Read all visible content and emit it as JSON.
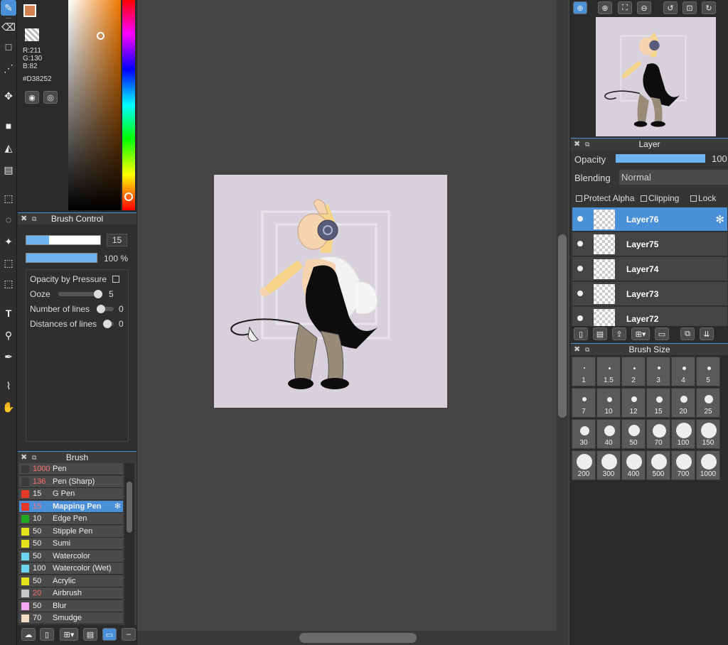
{
  "color": {
    "r_label": "R:211",
    "g_label": "G:130",
    "b_label": "B:82",
    "hex_label": "#D38252",
    "foreground": "#D38252",
    "accent": "#4A90D9"
  },
  "brush_control": {
    "title": "Brush Control",
    "size_value": "15",
    "opacity_value": "100 %",
    "opacity_by_pressure": "Opacity by Pressure",
    "ooze_label": "Ooze",
    "ooze_value": "5",
    "lines_label": "Number of lines",
    "lines_value": "0",
    "dist_label": "Distances of lines",
    "dist_value": "0"
  },
  "brush": {
    "title": "Brush",
    "items": [
      {
        "size": "1000",
        "name": "Pen",
        "color": "#3a3a3a",
        "red": true
      },
      {
        "size": "136",
        "name": "Pen (Sharp)",
        "color": "#3a3a3a",
        "red": true
      },
      {
        "size": "15",
        "name": "G Pen",
        "color": "#e53a2a",
        "red": false
      },
      {
        "size": "15",
        "name": "Mapping Pen",
        "color": "#e53a2a",
        "red": true
      },
      {
        "size": "10",
        "name": "Edge Pen",
        "color": "#21a821",
        "red": false
      },
      {
        "size": "50",
        "name": "Stipple Pen",
        "color": "#e8e21a",
        "red": false
      },
      {
        "size": "50",
        "name": "Sumi",
        "color": "#e8e21a",
        "red": false
      },
      {
        "size": "50",
        "name": "Watercolor",
        "color": "#6ed4f0",
        "red": false
      },
      {
        "size": "100",
        "name": "Watercolor (Wet)",
        "color": "#6ed4f0",
        "red": false
      },
      {
        "size": "50",
        "name": "Acrylic",
        "color": "#e8e21a",
        "red": false
      },
      {
        "size": "20",
        "name": "Airbrush",
        "color": "#c8c8c8",
        "red": true
      },
      {
        "size": "50",
        "name": "Blur",
        "color": "#f4a6f0",
        "red": false
      },
      {
        "size": "70",
        "name": "Smudge",
        "color": "#f6dcc4",
        "red": false
      }
    ]
  },
  "layer": {
    "title": "Layer",
    "opacity_label": "Opacity",
    "opacity_value": "100",
    "blending_label": "Blending",
    "blending_value": "Normal",
    "protect_alpha": "Protect Alpha",
    "clipping": "Clipping",
    "lock": "Lock",
    "layers": [
      "Layer76",
      "Layer75",
      "Layer74",
      "Layer73",
      "Layer72"
    ]
  },
  "brush_size": {
    "title": "Brush Size",
    "sizes": [
      "1",
      "1.5",
      "2",
      "3",
      "4",
      "5",
      "7",
      "10",
      "12",
      "15",
      "20",
      "25",
      "30",
      "40",
      "50",
      "70",
      "100",
      "150",
      "200",
      "300",
      "400",
      "500",
      "700",
      "1000"
    ]
  }
}
